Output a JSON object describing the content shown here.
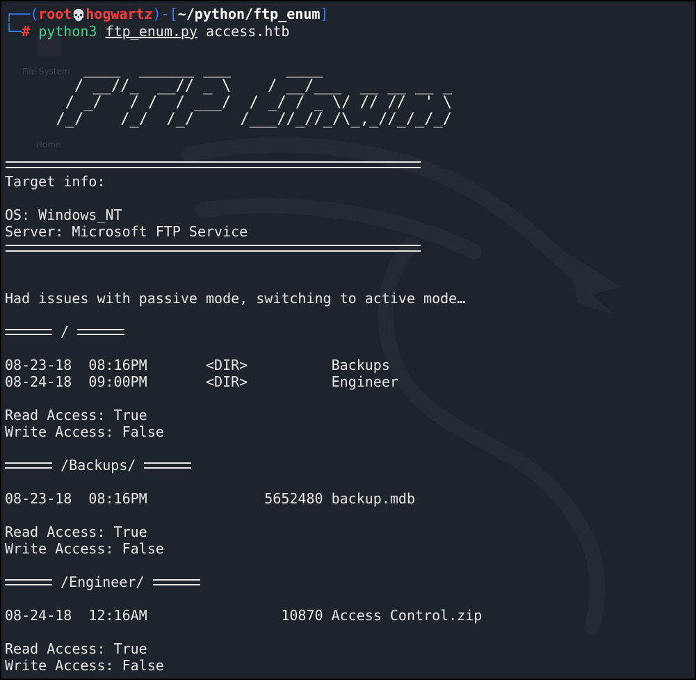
{
  "prompt": {
    "open_bracket": "┌──(",
    "user": "root",
    "skull": "💀",
    "host": "hogwartz",
    "close_bracket_mid": ")-[",
    "path": "~/python/ftp_enum",
    "close_bracket_end": "]",
    "corner": "└─",
    "hash": "#",
    "command": "python3",
    "script": "ftp_enum.py",
    "argument": "access.htb"
  },
  "desktop_ghost": {
    "filesystem_label": "File System",
    "home_label": "Home"
  },
  "banner": {
    "ascii": "     ____  ______ ___      ____\n    / __//_  __// _ \\    / __/___  __ __ __ _\n   / _/   / /  / ___/  / _/ / _ \\/ // //  ' \\\n  /_/    /_/  /_/     /___//_//_/\\_,_//_/_/_/"
  },
  "target_info": {
    "heading": "Target info:",
    "os": "OS: Windows_NT",
    "server": "Server: Microsoft FTP Service"
  },
  "notice": "Had issues with passive mode, switching to active mode…",
  "sections": [
    {
      "title": " / ",
      "rows": [
        "08-23-18  08:16PM       <DIR>          Backups",
        "08-24-18  09:00PM       <DIR>          Engineer"
      ],
      "read": "Read Access: True",
      "write": "Write Access: False"
    },
    {
      "title": " /Backups/ ",
      "rows": [
        "08-23-18  08:16PM              5652480 backup.mdb"
      ],
      "read": "Read Access: True",
      "write": "Write Access: False"
    },
    {
      "title": " /Engineer/ ",
      "rows": [
        "08-24-18  12:16AM                10870 Access Control.zip"
      ],
      "read": "Read Access: True",
      "write": "Write Access: False"
    }
  ],
  "colors": {
    "background": "#1f232c",
    "prompt_blue": "#3d7cf0",
    "prompt_red": "#ff3b3b",
    "command_green": "#3fd08a",
    "text": "#e8e8e8"
  }
}
